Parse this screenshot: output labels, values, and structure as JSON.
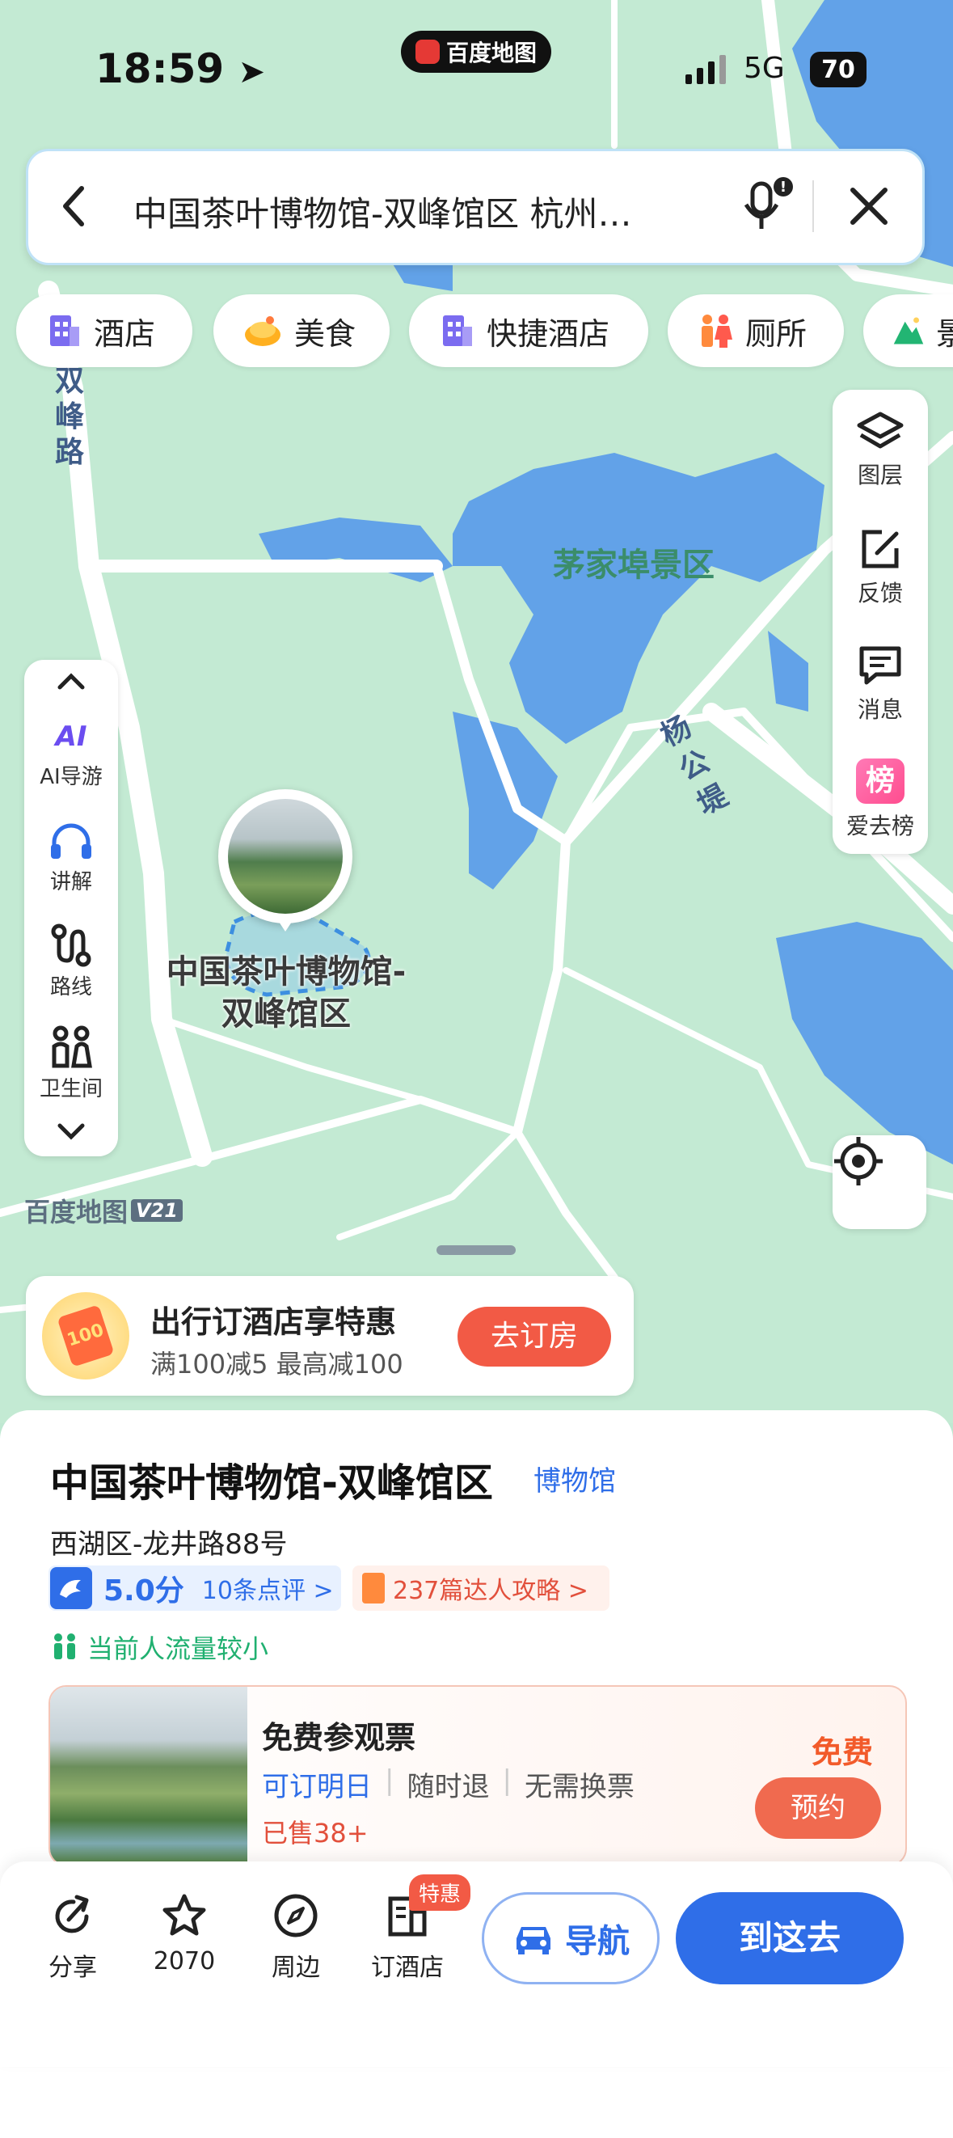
{
  "status": {
    "time": "18:59",
    "app_badge": "百度地图",
    "network": "5G",
    "battery": "70"
  },
  "search": {
    "query": "中国茶叶博物馆-双峰馆区 杭州…"
  },
  "chips": [
    {
      "label": "酒店",
      "icon": "hotel-icon"
    },
    {
      "label": "美食",
      "icon": "food-icon"
    },
    {
      "label": "快捷酒店",
      "icon": "budget-hotel-icon"
    },
    {
      "label": "厕所",
      "icon": "toilet-icon"
    },
    {
      "label": "景",
      "icon": "scenic-icon"
    }
  ],
  "right_tools": {
    "layers": "图层",
    "feedback": "反馈",
    "messages": "消息",
    "ranking_badge": "榜",
    "ranking": "爱去榜"
  },
  "left_tools": {
    "ai_badge": "AI",
    "ai_guide": "AI导游",
    "audio": "讲解",
    "route": "路线",
    "toilet": "卫生间"
  },
  "map": {
    "road_shuangfeng": "双峰路",
    "scenic_area": "茅家埠景区",
    "road_yanggongdi": "杨公堤",
    "poi_name_line1": "中国茶叶博物馆-",
    "poi_name_line2": "双峰馆区",
    "watermark": "百度地图",
    "version": "V21"
  },
  "promo": {
    "badge": "100",
    "title": "出行订酒店享特惠",
    "subtitle": "满100减5 最高减100",
    "button": "去订房"
  },
  "place": {
    "name": "中国茶叶博物馆-双峰馆区",
    "category": "博物馆",
    "address": "西湖区-龙井路88号",
    "rating": "5.0分",
    "reviews": "10条点评 >",
    "guides": "237篇达人攻略 >",
    "crowd": "当前人流量较小"
  },
  "ticket": {
    "title": "免费参观票",
    "tags": [
      "可订明日",
      "随时退",
      "无需换票"
    ],
    "sold": "已售38+",
    "price": "免费",
    "button": "预约"
  },
  "bottom_bar": {
    "share": "分享",
    "favorite_count": "2070",
    "nearby": "周边",
    "hotel_badge": "特惠",
    "hotel": "订酒店",
    "navigate": "导航",
    "go_here": "到这去"
  },
  "colors": {
    "accent_blue": "#2f6ee8",
    "promo_red": "#f25a45",
    "map_green": "#c3ead3",
    "water_blue": "#5f9fe6"
  }
}
